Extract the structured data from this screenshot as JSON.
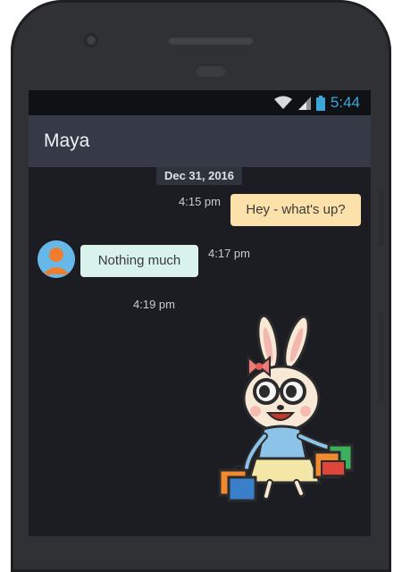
{
  "status_bar": {
    "time": "5:44",
    "icons": [
      "wifi-icon",
      "signal-icon",
      "battery-icon"
    ]
  },
  "toolbar": {
    "title": "Maya"
  },
  "chat": {
    "date": "Dec 31, 2016",
    "messages": [
      {
        "direction": "outgoing",
        "text": "Hey - what's up?",
        "time": "4:15 pm"
      },
      {
        "direction": "incoming",
        "text": "Nothing much",
        "time": "4:17 pm"
      },
      {
        "direction": "outgoing",
        "type": "sticker",
        "sticker": "bunny-shopping-sticker",
        "time": "4:19 pm"
      }
    ]
  },
  "colors": {
    "screen_bg": "#1b1d22",
    "toolbar_bg": "#353a46",
    "outgoing_bubble": "#fde1ab",
    "incoming_bubble": "#d9f3ec",
    "status_time": "#3aa7d8"
  }
}
